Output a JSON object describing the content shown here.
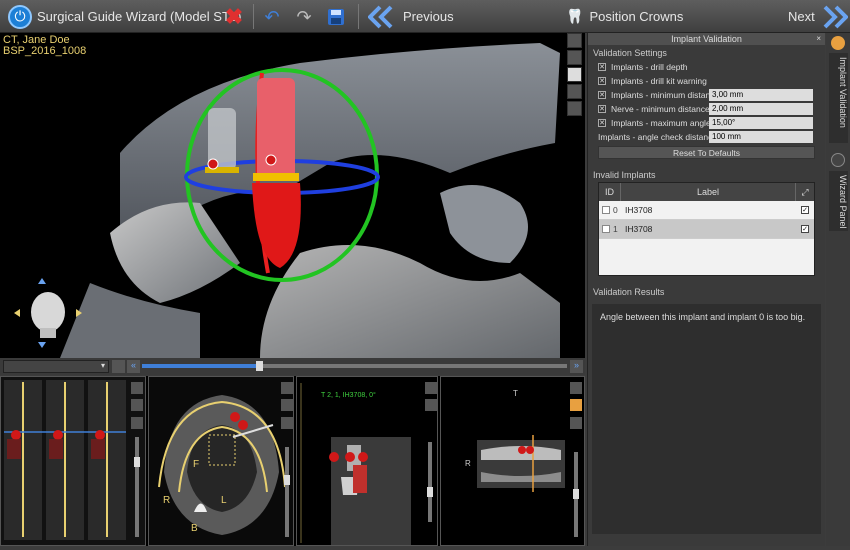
{
  "toolbar": {
    "title": "Surgical Guide Wizard (Model STL)",
    "previous_label": "Previous",
    "position_crowns_label": "Position Crowns",
    "next_label": "Next"
  },
  "patient": {
    "name": "CT, Jane Doe",
    "case_id": "BSP_2016_1008"
  },
  "slice_panel_label": "T 2, 1, IH3708, 0°",
  "orientation": {
    "right": "R",
    "left": "L",
    "front": "F",
    "back": "B",
    "top": "T"
  },
  "right_panel": {
    "header": "Implant Validation",
    "validation_settings_title": "Validation Settings",
    "settings": [
      {
        "label": "Implants - drill depth",
        "checked": true
      },
      {
        "label": "Implants - drill kit warning",
        "checked": true
      },
      {
        "label": "Implants - minimum distance",
        "checked": true,
        "value": "3,00 mm"
      },
      {
        "label": "Nerve - minimum distance",
        "checked": true,
        "value": "2,00 mm"
      },
      {
        "label": "Implants - maximum angle",
        "checked": true,
        "value": "15,00°"
      }
    ],
    "angle_check_label": "Implants - angle check distance",
    "angle_check_value": "100 mm",
    "reset_button": "Reset To Defaults",
    "invalid_implants_title": "Invalid Implants",
    "table": {
      "col_id": "ID",
      "col_label": "Label",
      "rows": [
        {
          "id": "0",
          "label": "IH3708",
          "checked": true
        },
        {
          "id": "1",
          "label": "IH3708",
          "checked": true
        }
      ]
    },
    "results_title": "Validation Results",
    "results_text": "Angle between this implant and implant 0 is too big."
  },
  "side_tabs": {
    "tab1": "Implant Validation",
    "tab2": "Wizard Panel"
  },
  "colors": {
    "accent_blue": "#3f7fd8",
    "delete_red": "#e03030",
    "ring_green": "#22c422",
    "ring_red": "#e82020",
    "ring_blue": "#1f3fe0",
    "implant_red": "#e01818"
  }
}
